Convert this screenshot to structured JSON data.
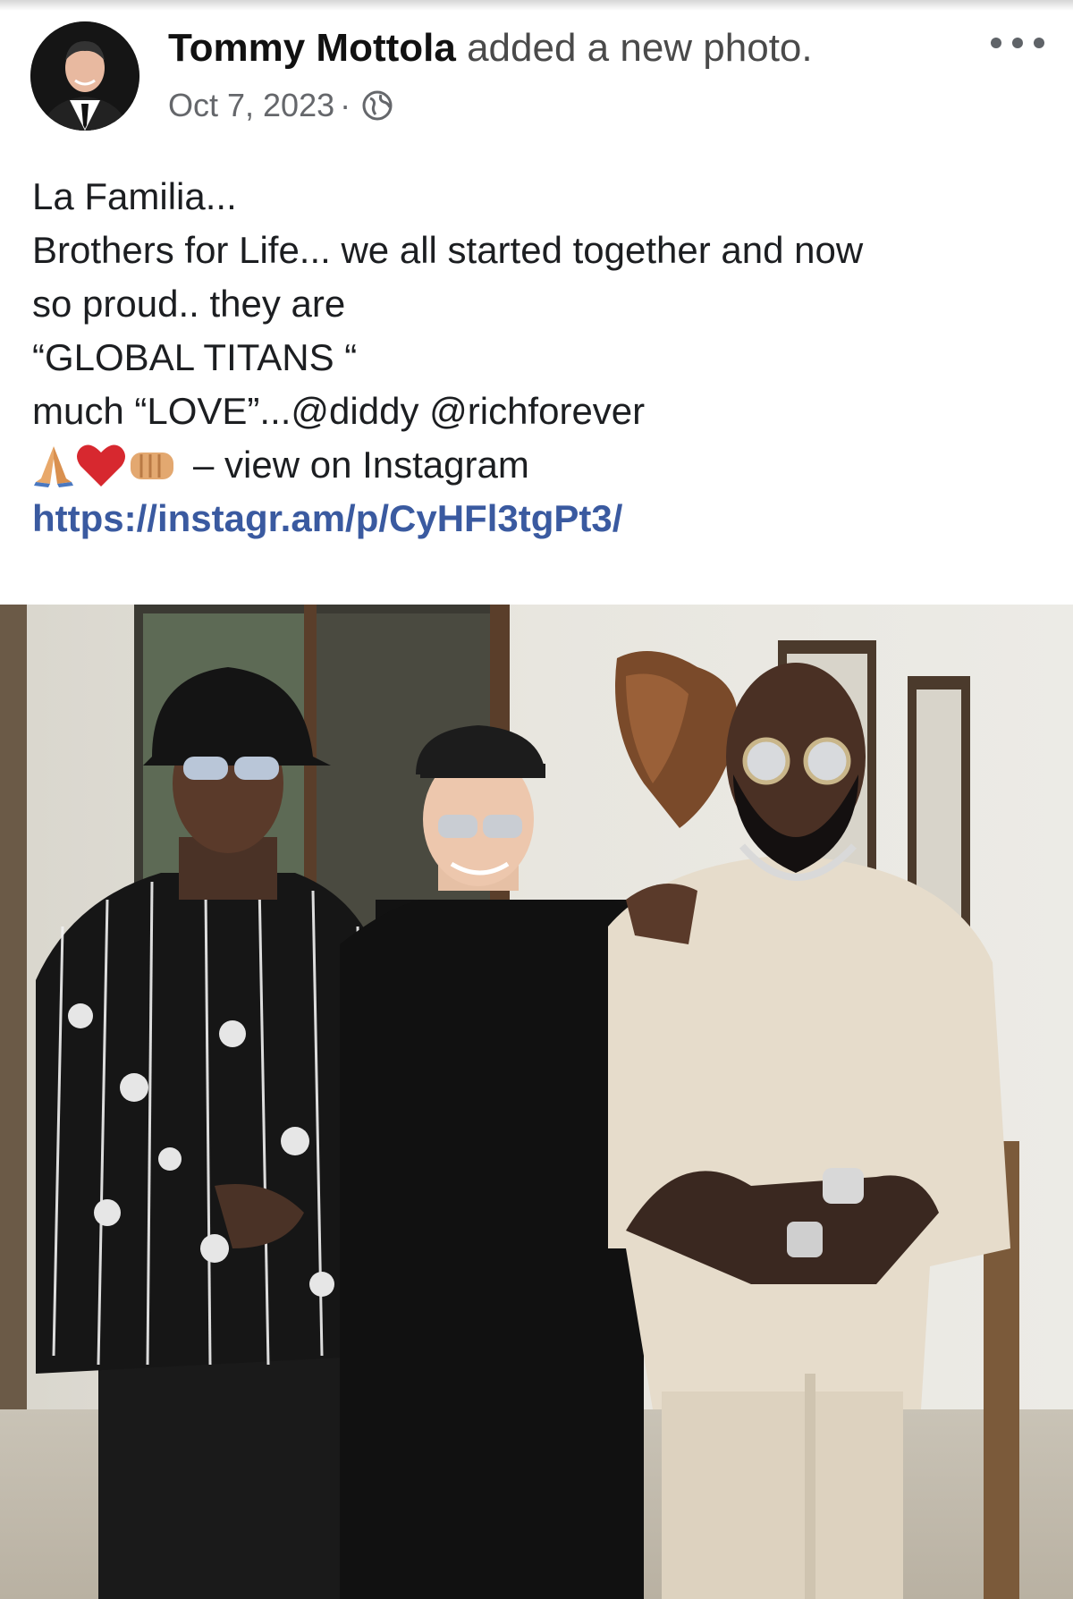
{
  "post": {
    "author_name": "Tommy Mottola",
    "action_text": "added a new photo.",
    "date": "Oct 7, 2023",
    "separator": "·",
    "privacy_icon": "globe-icon",
    "more_icon": "more-options-icon"
  },
  "caption": {
    "lines": [
      "La Familia...",
      "Brothers for Life... we all started together and now",
      "so proud.. they are",
      "“GLOBAL TITANS “",
      "much “LOVE”...@diddy  @richforever"
    ],
    "emoji_icons": [
      "folded-hands-icon",
      "red-heart-icon",
      "fist-bump-icon"
    ],
    "instagram_text": "– view on Instagram",
    "link": "https://instagr.am/p/CyHFl3tgPt3/"
  },
  "colors": {
    "link": "#3a5aa0",
    "meta": "#65676b",
    "text": "#1c1e21"
  }
}
